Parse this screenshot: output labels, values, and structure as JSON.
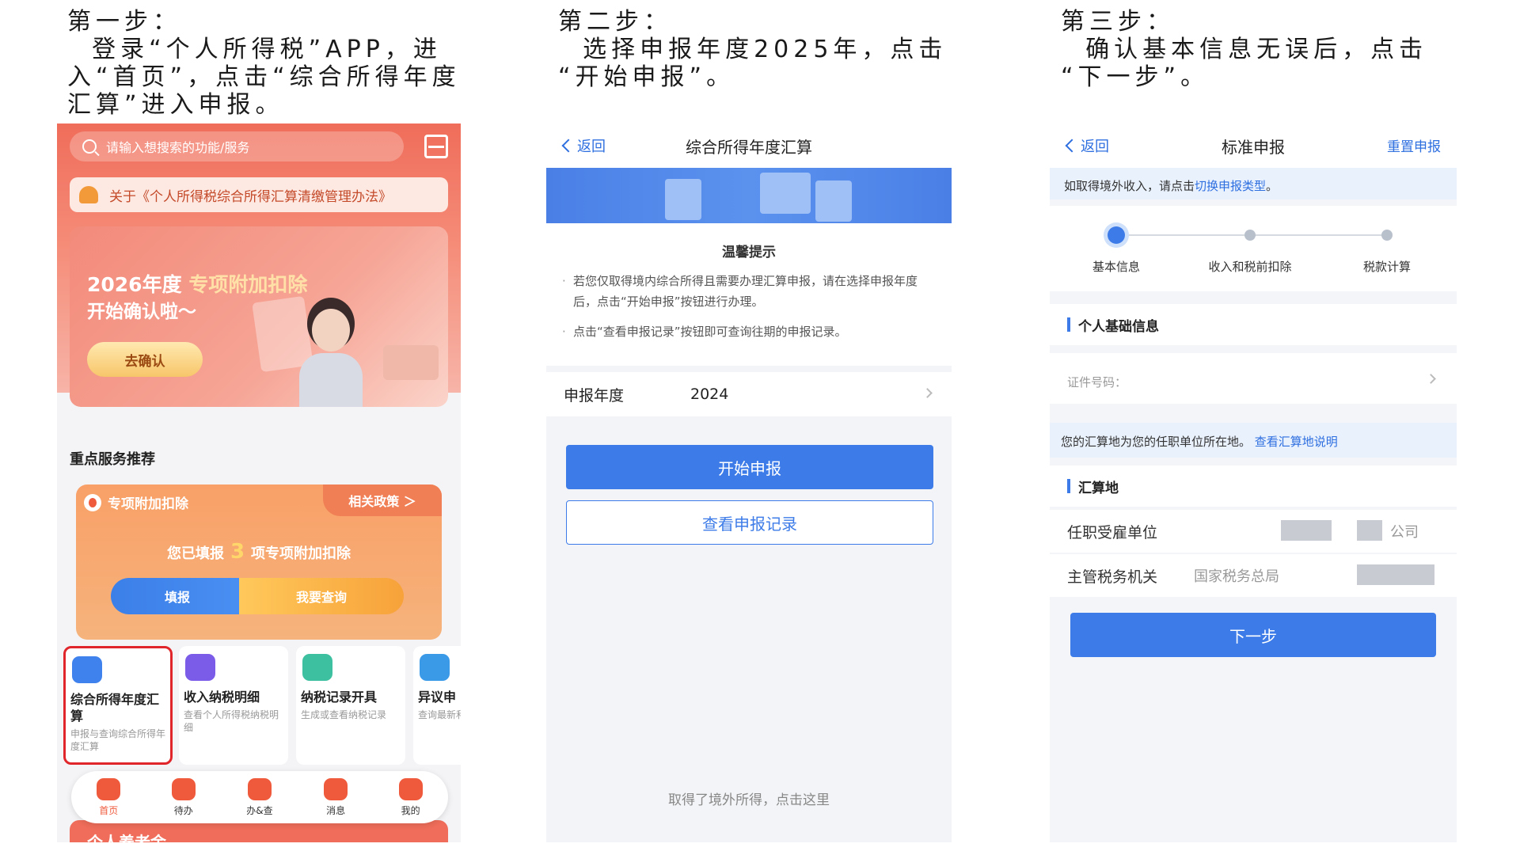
{
  "steps": [
    {
      "lines": [
        "第一步：",
        "  登录“个人所得税”APP，进",
        "入“首页”，点击“综合所得年度",
        "汇算”进入申报。"
      ]
    },
    {
      "lines": [
        "第二步：",
        "  选择申报年度2025年，点击",
        "“开始申报”。"
      ]
    },
    {
      "lines": [
        "第三步：",
        "  确认基本信息无误后，点击",
        "“下一步”。"
      ]
    }
  ],
  "phone1": {
    "search_placeholder": "请输入想搜索的功能/服务",
    "notice": "关于《个人所得税综合所得汇算清缴管理办法》",
    "banner": {
      "year": "2026年度",
      "highlight": "专项附加扣除",
      "subtitle": "开始确认啦～",
      "button": "去确认"
    },
    "section_title": "重点服务推荐",
    "card": {
      "title": "专项附加扣除",
      "policy": "相关政策 ＞",
      "msg_prefix": "您已填报",
      "count": "3",
      "msg_suffix": "项专项附加扣除",
      "btn_fill": "填报",
      "btn_query": "我要查询"
    },
    "services": [
      {
        "name": "综合所得年度汇算",
        "desc": "申报与查询综合所得年度汇算",
        "color": "#3f82ee"
      },
      {
        "name": "收入纳税明细",
        "desc": "查看个人所得税纳税明细",
        "color": "#7a5ce8"
      },
      {
        "name": "纳税记录开具",
        "desc": "生成或查看纳税记录",
        "color": "#3cc0a0"
      },
      {
        "name": "异议申",
        "desc": "查询最新和结果",
        "color": "#3a9ae8"
      }
    ],
    "tabs": [
      "首页",
      "待办",
      "办&查",
      "消息",
      "我的"
    ],
    "bottom": "个人养老金"
  },
  "phone2": {
    "back": "返回",
    "title": "综合所得年度汇算",
    "tip_title": "温馨提示",
    "tip1": "若您仅取得境内综合所得且需要办理汇算申报，请在选择申报年度后，点击“开始申报”按钮进行办理。",
    "tip2": "点击“查看申报记录”按钮即可查询往期的申报记录。",
    "year_label": "申报年度",
    "year_value": "2024",
    "btn_start": "开始申报",
    "btn_records": "查看申报记录",
    "foot": "取得了境外所得，点击这里"
  },
  "phone3": {
    "back": "返回",
    "title": "标准申报",
    "reset": "重置申报",
    "info_prefix": "如取得境外收入，请点击",
    "info_link": "切换申报类型",
    "info_suffix": "。",
    "step_labels": [
      "基本信息",
      "收入和税前扣除",
      "税款计算"
    ],
    "section1": "个人基础信息",
    "id_label": "证件号码：",
    "note_prefix": "您的汇算地为您的任职单位所在地。",
    "note_link": "查看汇算地说明",
    "section2": "汇算地",
    "employer_label": "任职受雇单位",
    "employer_value": "公司",
    "tax_label": "主管税务机关",
    "tax_value": "国家税务总局",
    "btn_next": "下一步"
  }
}
